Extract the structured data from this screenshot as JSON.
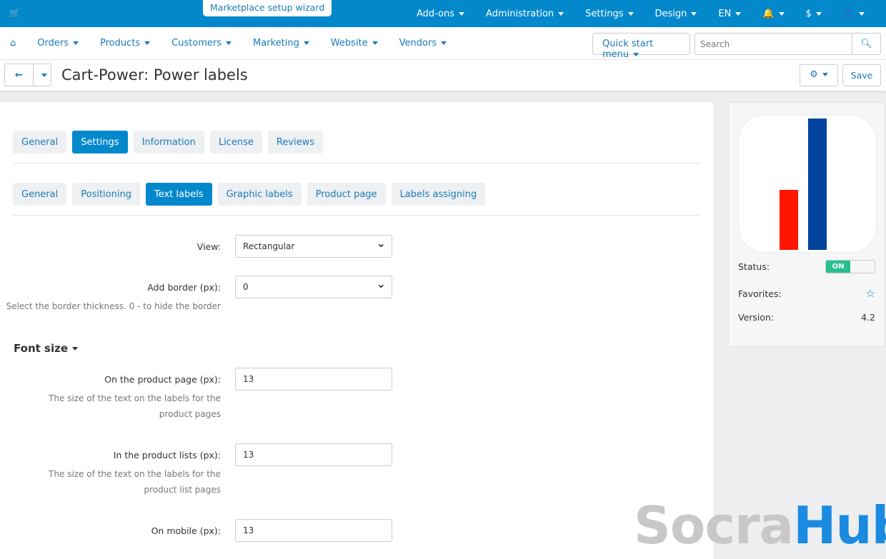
{
  "topbar": {
    "wizard": "Marketplace setup wizard",
    "menu": [
      "Add-ons",
      "Administration",
      "Settings",
      "Design",
      "EN"
    ],
    "currency": "$"
  },
  "nav": {
    "items": [
      "Orders",
      "Products",
      "Customers",
      "Marketing",
      "Website",
      "Vendors"
    ],
    "quick_start": "Quick start menu",
    "search_placeholder": "Search"
  },
  "page": {
    "title": "Cart-Power: Power labels",
    "save": "Save"
  },
  "tabs": [
    "General",
    "Settings",
    "Information",
    "License",
    "Reviews"
  ],
  "subtabs": [
    "General",
    "Positioning",
    "Text labels",
    "Graphic labels",
    "Product page",
    "Labels assigning"
  ],
  "form": {
    "view_label": "View:",
    "view_value": "Rectangular",
    "border_label": "Add border (px):",
    "border_value": "0",
    "border_hint": "Select the border thickness. 0 - to hide the border",
    "font_heading": "Font size",
    "product_page_label": "On the product page (px):",
    "product_page_value": "13",
    "product_page_hint": "The size of the text on the labels for the product pages",
    "lists_label": "In the product lists (px):",
    "lists_value": "13",
    "lists_hint": "The size of the text on the labels for the product list pages",
    "mobile_label": "On mobile (px):",
    "mobile_value": "13"
  },
  "sidebar": {
    "status_label": "Status:",
    "status_value": "ON",
    "favorites_label": "Favorites:",
    "version_label": "Version:",
    "version_value": "4.2"
  },
  "watermark": {
    "part1": "Socra",
    "part2": "Hub"
  }
}
